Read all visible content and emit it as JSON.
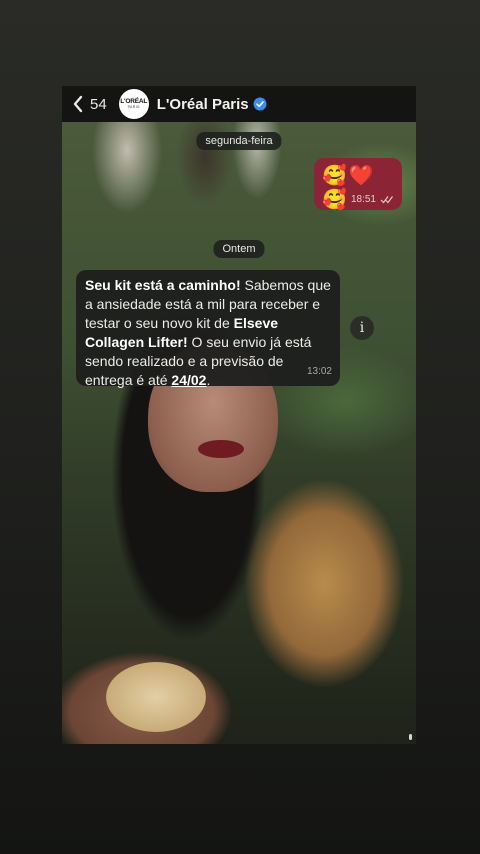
{
  "header": {
    "back_count": "54",
    "contact_name": "L'Oréal Paris",
    "logo_text": "L'ORÉAL",
    "logo_sub": "PARIS",
    "verified": true
  },
  "chat": {
    "date_chip_1": "segunda-feira",
    "date_chip_2": "Ontem",
    "outgoing": {
      "emojis": "🥰❤️🥰",
      "time": "18:51",
      "status_icon": "double-check-icon"
    },
    "incoming": {
      "bold_1": "Seu kit está a caminho!",
      "text_1": " Sabemos que a ansiedade está a mil para receber e testar o seu novo kit de ",
      "bold_2": "Elseve Collagen Lifter!",
      "text_2": " O seu envio já está sendo realizado e a previsão de entrega é até ",
      "date_underlined": "24/02",
      "text_3": ".",
      "time": "13:02"
    },
    "info_button": "i"
  },
  "colors": {
    "outgoing_bubble": "#8b2535",
    "incoming_bubble": "#1e1f1d",
    "verified_badge": "#3b8cf0"
  }
}
